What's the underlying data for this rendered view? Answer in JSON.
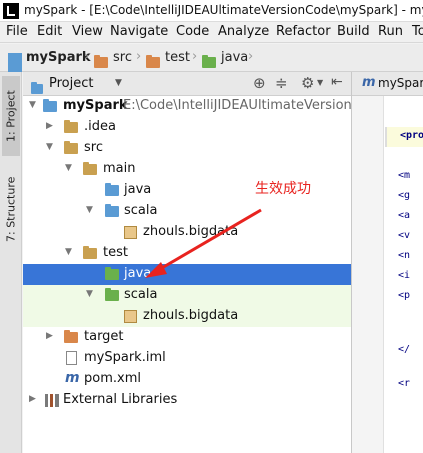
{
  "window": {
    "title": "mySpark - [E:\\Code\\IntelliJIDEAUltimateVersionCode\\mySpark] - myS"
  },
  "menu": [
    "File",
    "Edit",
    "View",
    "Navigate",
    "Code",
    "Analyze",
    "Refactor",
    "Build",
    "Run",
    "To"
  ],
  "breadcrumb": [
    "mySpark",
    "src",
    "test",
    "java"
  ],
  "sidebar_tabs": {
    "project": "1: Project",
    "structure": "7: Structure"
  },
  "project_panel": {
    "title": "Project"
  },
  "tree": [
    {
      "label": "mySpark",
      "path": "E:\\Code\\IntelliJIDEAUltimateVersionCode"
    },
    {
      "label": ".idea"
    },
    {
      "label": "src"
    },
    {
      "label": "main"
    },
    {
      "label": "java"
    },
    {
      "label": "scala"
    },
    {
      "label": "zhouls.bigdata"
    },
    {
      "label": "test"
    },
    {
      "label": "java"
    },
    {
      "label": "scala"
    },
    {
      "label": "zhouls.bigdata"
    },
    {
      "label": "target"
    },
    {
      "label": "mySpark.iml"
    },
    {
      "label": "pom.xml"
    },
    {
      "label": "External Libraries"
    }
  ],
  "annotation": {
    "text": "生效成功",
    "color": "#e8231f"
  },
  "editor": {
    "tab_label": "mySpar",
    "tag_samples": [
      "<pro",
      "<m",
      "<g",
      "<a",
      "<v",
      "<n",
      "<i",
      "<p",
      "</",
      "<r"
    ]
  },
  "colors": {
    "selection": "#3875d7",
    "test_tint": "#f0fae6",
    "folder_blue": "#5a9bd4",
    "folder_brown": "#d9874a",
    "folder_green": "#6ab04c"
  }
}
